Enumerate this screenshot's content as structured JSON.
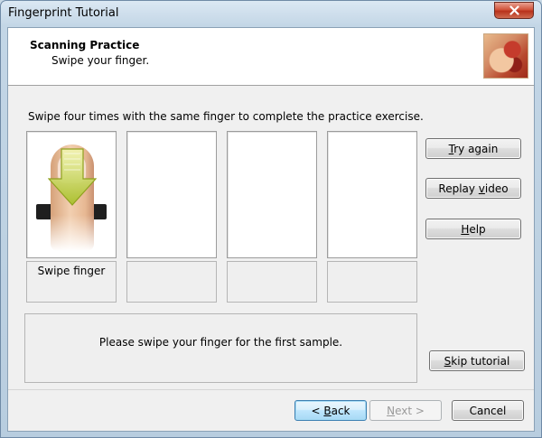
{
  "window": {
    "title": "Fingerprint Tutorial"
  },
  "header": {
    "title": "Scanning Practice",
    "subtitle": "Swipe your finger.",
    "image_icon": "fingerprint-reader-photo"
  },
  "instruction": "Swipe four times with the same finger to complete the practice exercise.",
  "samples": [
    {
      "label": "Swipe finger",
      "state": "active"
    },
    {
      "label": "",
      "state": "empty"
    },
    {
      "label": "",
      "state": "empty"
    },
    {
      "label": "",
      "state": "empty"
    }
  ],
  "side_buttons": {
    "try_again": {
      "pre": "",
      "key": "T",
      "post": "ry again"
    },
    "replay_video": {
      "pre": "Replay ",
      "key": "v",
      "post": "ideo"
    },
    "help": {
      "pre": "",
      "key": "H",
      "post": "elp"
    },
    "skip_tutorial": {
      "pre": "",
      "key": "S",
      "post": "kip tutorial"
    }
  },
  "status_message": "Please swipe your finger for the first sample.",
  "footer": {
    "back": {
      "pre": "< ",
      "key": "B",
      "post": "ack"
    },
    "next": {
      "pre": "",
      "key": "N",
      "post": "ext >"
    },
    "cancel": "Cancel"
  },
  "colors": {
    "accent": "#3c7fb1",
    "close_button": "#c8452f",
    "arrow": "#b6c936"
  }
}
